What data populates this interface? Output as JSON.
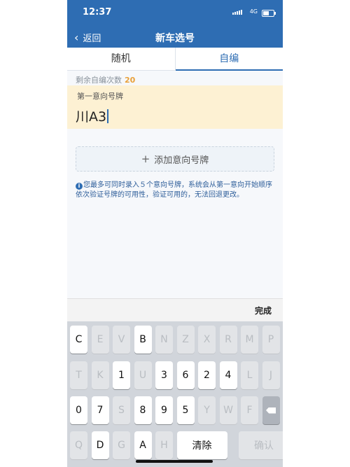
{
  "status": {
    "time": "12:37",
    "network": "4G"
  },
  "nav": {
    "back_label": "返回",
    "title": "新车选号"
  },
  "tabs": [
    {
      "label": "随机",
      "active": false
    },
    {
      "label": "自编",
      "active": true
    }
  ],
  "remaining": {
    "label": "剩余自编次数",
    "count": "20"
  },
  "plate": {
    "label": "第一意向号牌",
    "value": "川A3"
  },
  "add_button": {
    "label": "添加意向号牌"
  },
  "notice": {
    "text": "您最多可同时录入５个意向号牌，系统会从第一意向开始顺序依次验证号牌的可用性，验证可用的，无法回退更改。"
  },
  "keyboard": {
    "done_label": "完成",
    "row1": [
      {
        "k": "C",
        "on": true
      },
      {
        "k": "E",
        "on": false
      },
      {
        "k": "V",
        "on": false
      },
      {
        "k": "B",
        "on": true
      },
      {
        "k": "N",
        "on": false
      },
      {
        "k": "Z",
        "on": false
      },
      {
        "k": "X",
        "on": false
      },
      {
        "k": "R",
        "on": false
      },
      {
        "k": "M",
        "on": false
      },
      {
        "k": "P",
        "on": false
      }
    ],
    "row2": [
      {
        "k": "T",
        "on": false
      },
      {
        "k": "K",
        "on": false
      },
      {
        "k": "1",
        "on": true
      },
      {
        "k": "U",
        "on": false
      },
      {
        "k": "3",
        "on": true
      },
      {
        "k": "6",
        "on": true
      },
      {
        "k": "2",
        "on": true
      },
      {
        "k": "4",
        "on": true
      },
      {
        "k": "L",
        "on": false
      },
      {
        "k": "J",
        "on": false
      }
    ],
    "row3": [
      {
        "k": "0",
        "on": true
      },
      {
        "k": "7",
        "on": true
      },
      {
        "k": "S",
        "on": false
      },
      {
        "k": "8",
        "on": true
      },
      {
        "k": "9",
        "on": true
      },
      {
        "k": "5",
        "on": true
      },
      {
        "k": "Y",
        "on": false
      },
      {
        "k": "W",
        "on": false
      },
      {
        "k": "F",
        "on": false
      }
    ],
    "row4": [
      {
        "k": "Q",
        "on": false
      },
      {
        "k": "D",
        "on": true
      },
      {
        "k": "G",
        "on": false
      },
      {
        "k": "A",
        "on": true
      },
      {
        "k": "H",
        "on": false
      }
    ],
    "clear_label": "清除",
    "confirm_label": "确认",
    "backspace_icon": "backspace-icon"
  },
  "colors": {
    "primary": "#2e6db3",
    "highlight": "#fdf1d3",
    "count": "#e9a13b"
  }
}
